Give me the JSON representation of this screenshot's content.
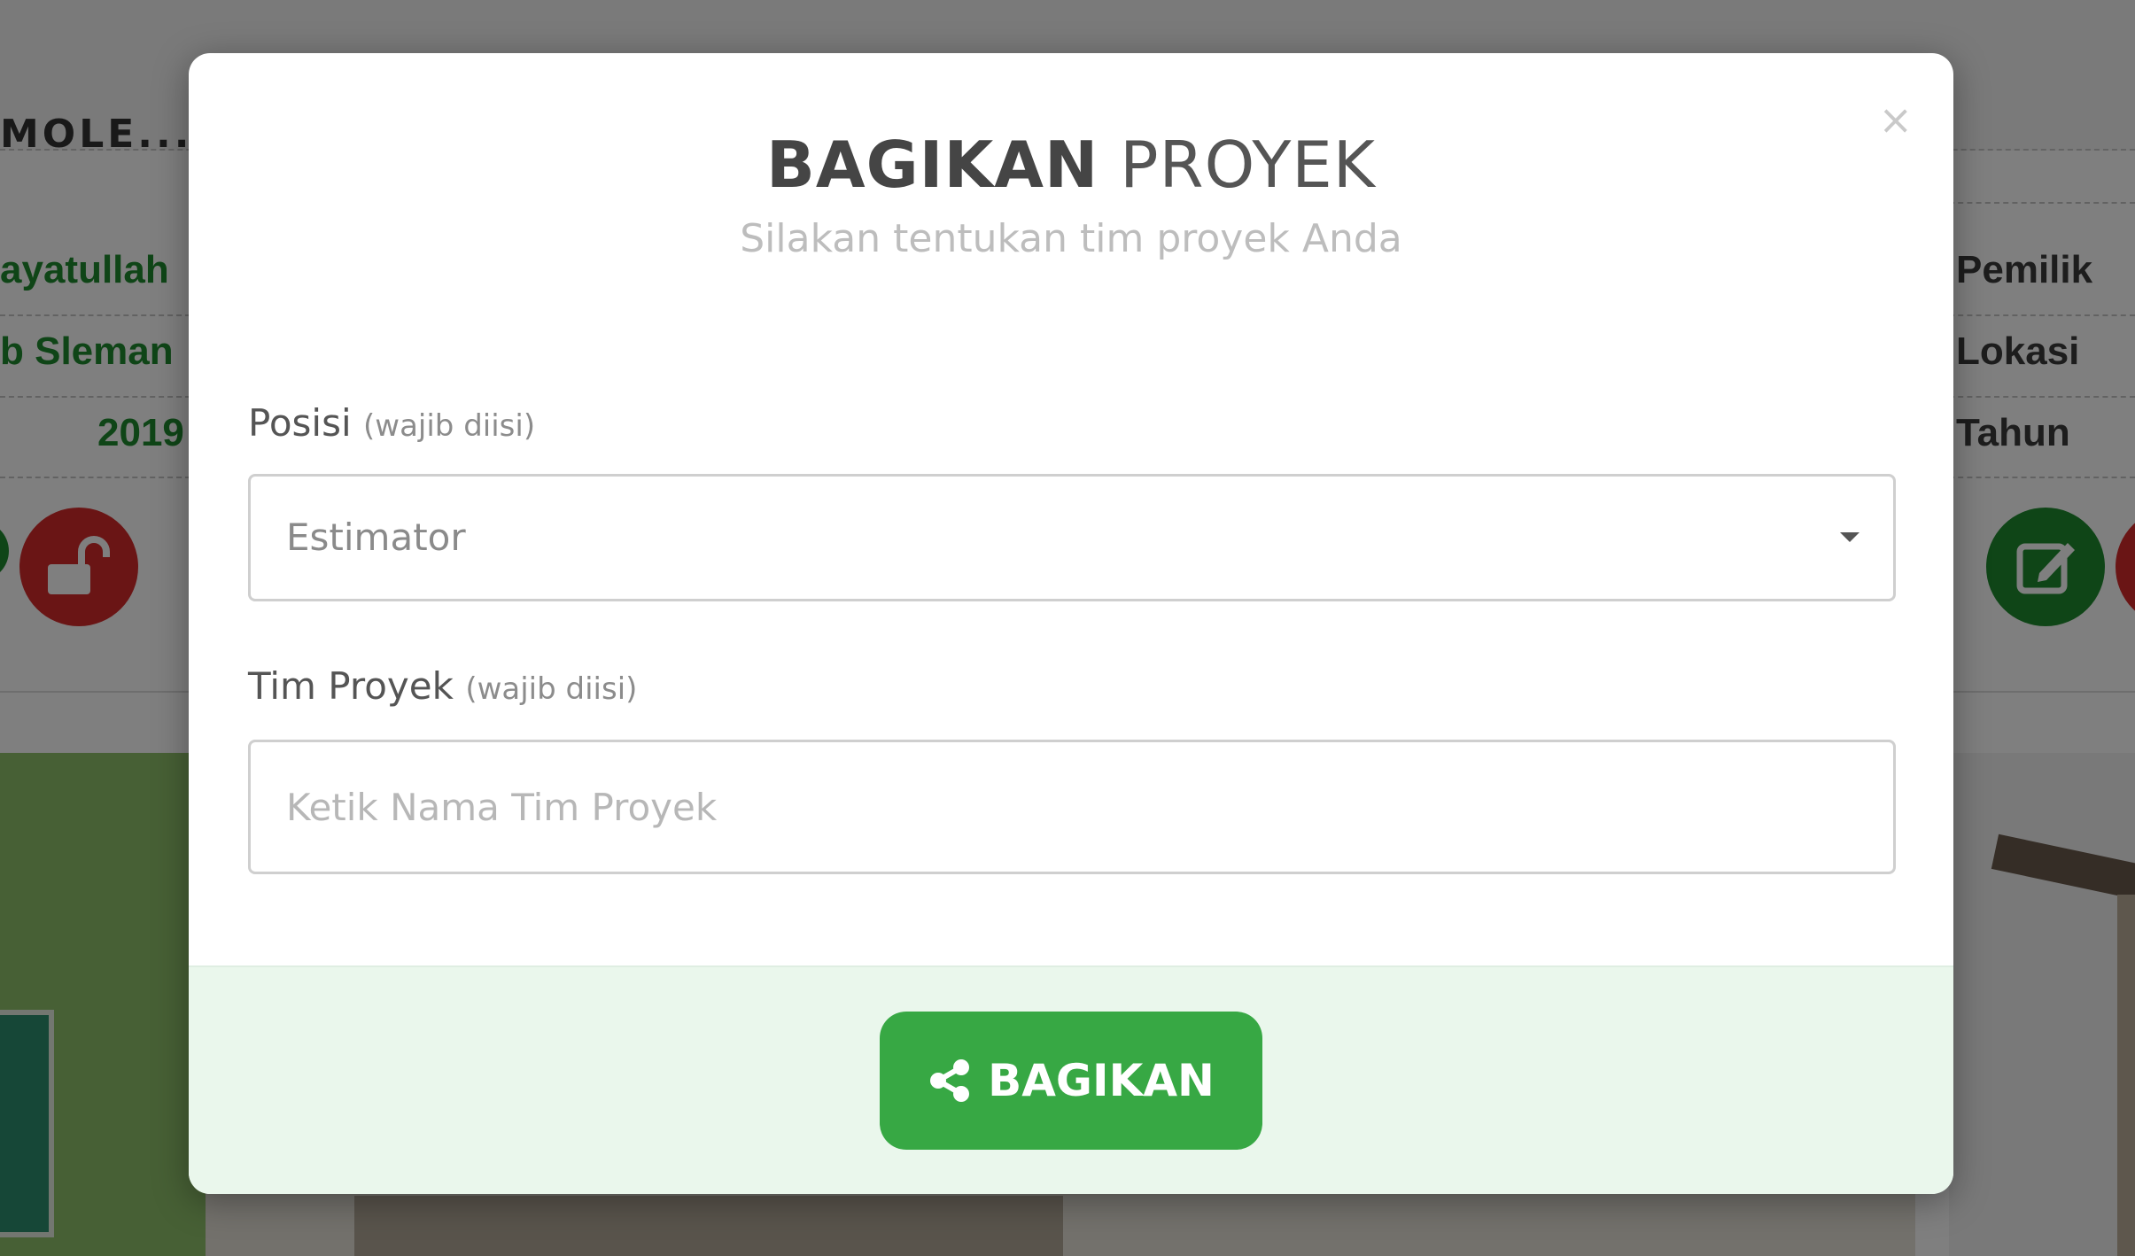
{
  "background": {
    "header_text": "MOLE...",
    "left_values": [
      "ayatullah",
      "b Sleman",
      "2019"
    ],
    "right_labels": [
      "Pemilik",
      "Lokasi",
      "Tahun"
    ],
    "icons": [
      "unlock-icon",
      "edit-icon"
    ],
    "colors": {
      "green_text": "#1f8a2f",
      "red_button": "#d42a2a",
      "green_button": "#1f8a2f"
    }
  },
  "modal": {
    "title_bold": "BAGIKAN",
    "title_light": "PROYEK",
    "subtitle": "Silakan tentukan tim proyek Anda",
    "close_icon": "close-icon",
    "posisi": {
      "label": "Posisi",
      "required_note": "(wajib diisi)",
      "selected": "Estimator"
    },
    "tim": {
      "label": "Tim Proyek",
      "required_note": "(wajib diisi)",
      "placeholder": "Ketik Nama Tim Proyek"
    },
    "share_button": {
      "label": "BAGIKAN",
      "icon": "share-icon",
      "color": "#37a844"
    },
    "footer_color": "#eaf7ec"
  }
}
